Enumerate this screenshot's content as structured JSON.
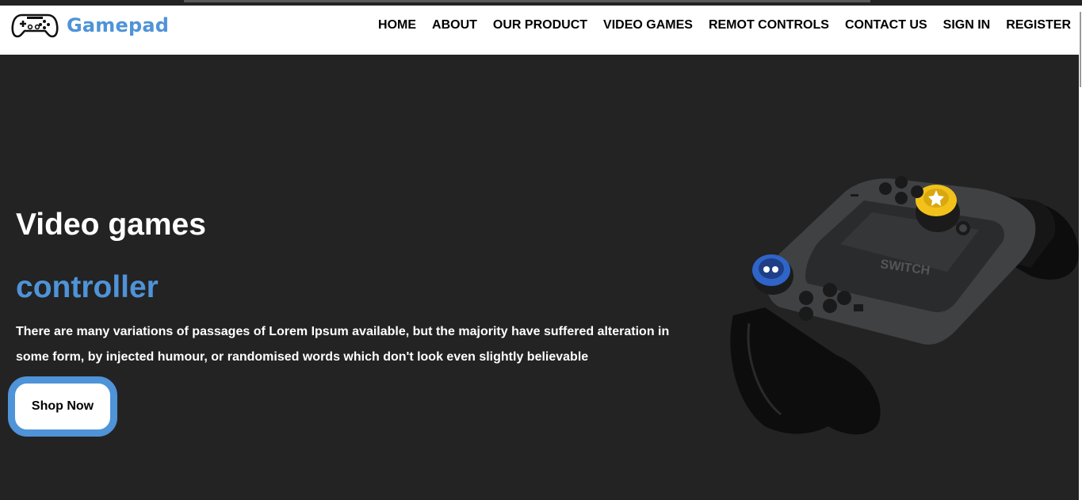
{
  "brand": {
    "name": "Gamepad",
    "icon": "gamepad-icon",
    "color": "#4f93d8"
  },
  "nav": {
    "items": [
      "HOME",
      "ABOUT",
      "OUR PRODUCT",
      "VIDEO GAMES",
      "REMOT CONTROLS",
      "CONTACT US",
      "SIGN IN",
      "REGISTER"
    ]
  },
  "hero": {
    "title": "Video games",
    "subtitle": "controller",
    "text": "There are many variations of passages of Lorem Ipsum available, but the majority have suffered alteration in some form, by injected humour, or randomised words which don't look even slightly believable",
    "button": "Shop Now"
  },
  "product_image": {
    "icon": "game-controller-image"
  },
  "colors": {
    "accent": "#4f93d8",
    "background": "#232323",
    "header": "#ffffff"
  }
}
